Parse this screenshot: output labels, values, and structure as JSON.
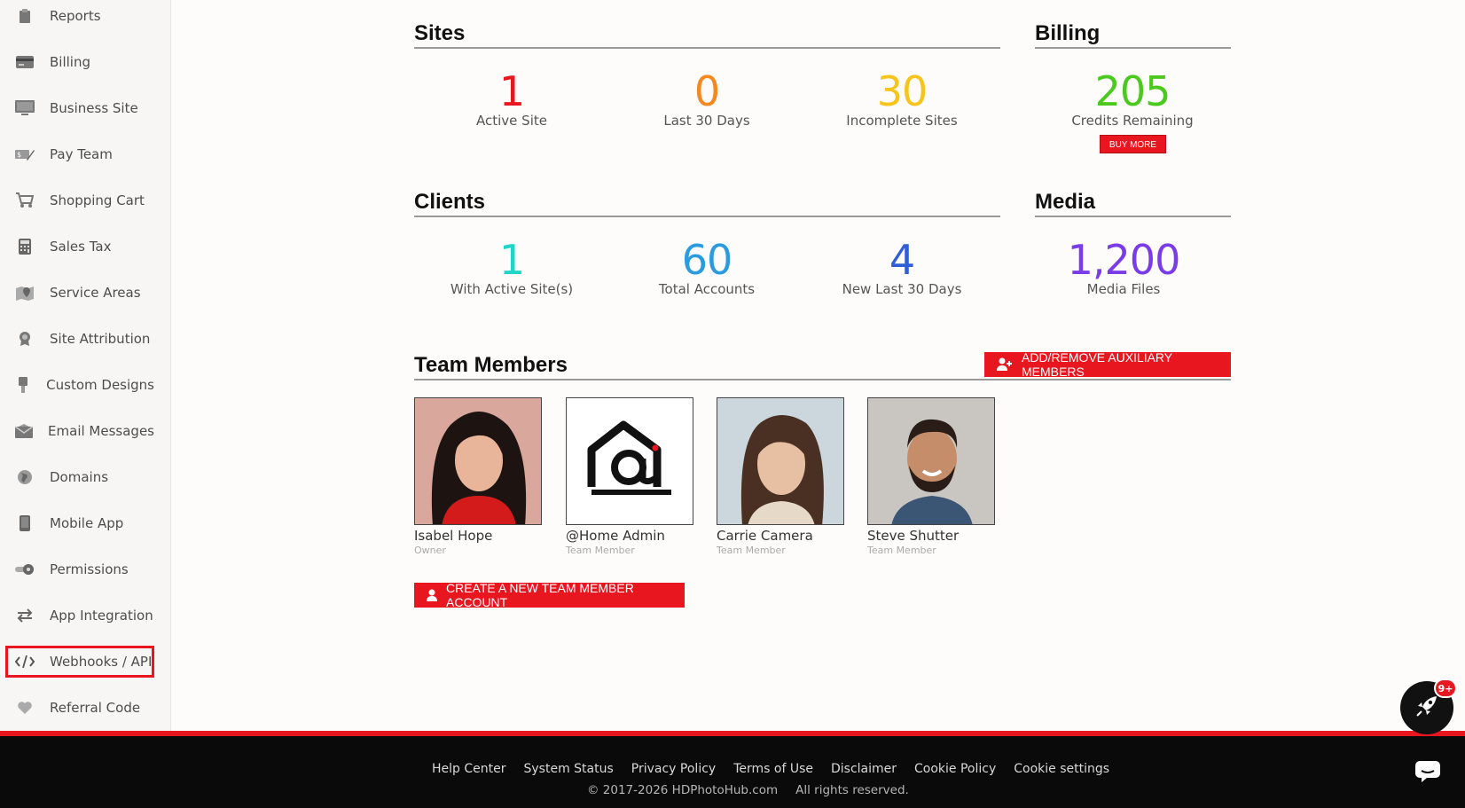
{
  "sidebar": {
    "items": [
      {
        "label": "Reports",
        "icon": "reports-icon"
      },
      {
        "label": "Billing",
        "icon": "credit-card-icon"
      },
      {
        "label": "Business Site",
        "icon": "monitor-icon"
      },
      {
        "label": "Pay Team",
        "icon": "pay-icon"
      },
      {
        "label": "Shopping Cart",
        "icon": "cart-icon"
      },
      {
        "label": "Sales Tax",
        "icon": "calculator-icon"
      },
      {
        "label": "Service Areas",
        "icon": "map-pin-icon"
      },
      {
        "label": "Site Attribution",
        "icon": "award-icon"
      },
      {
        "label": "Custom Designs",
        "icon": "brush-icon"
      },
      {
        "label": "Email Messages",
        "icon": "envelope-icon"
      },
      {
        "label": "Domains",
        "icon": "globe-icon"
      },
      {
        "label": "Mobile App",
        "icon": "mobile-icon"
      },
      {
        "label": "Permissions",
        "icon": "toggle-icon"
      },
      {
        "label": "App Integration",
        "icon": "arrows-icon"
      },
      {
        "label": "Webhooks / API",
        "icon": "code-icon",
        "active": true
      },
      {
        "label": "Referral Code",
        "icon": "heart-icon"
      }
    ]
  },
  "sites": {
    "title": "Sites",
    "stats": [
      {
        "value": "1",
        "caption": "Active Site",
        "color": "#e8161f"
      },
      {
        "value": "0",
        "caption": "Last 30 Days",
        "color": "#f5881f"
      },
      {
        "value": "30",
        "caption": "Incomplete Sites",
        "color": "#f7c41d"
      }
    ]
  },
  "billing": {
    "title": "Billing",
    "value": "205",
    "caption": "Credits Remaining",
    "color": "#4cc91f",
    "buy_label": "BUY MORE"
  },
  "clients": {
    "title": "Clients",
    "stats": [
      {
        "value": "1",
        "caption": "With Active Site(s)",
        "color": "#1fd6c8"
      },
      {
        "value": "60",
        "caption": "Total Accounts",
        "color": "#2b9be0"
      },
      {
        "value": "4",
        "caption": "New Last 30 Days",
        "color": "#2f5fd6"
      }
    ]
  },
  "media": {
    "title": "Media",
    "value": "1,200",
    "caption": "Media Files",
    "color": "#7a3be8"
  },
  "team": {
    "title": "Team Members",
    "add_remove_label": "ADD/REMOVE AUXILIARY MEMBERS",
    "create_label": "CREATE A NEW TEAM MEMBER ACCOUNT",
    "members": [
      {
        "name": "Isabel Hope",
        "role": "Owner"
      },
      {
        "name": "@Home Admin",
        "role": "Team Member"
      },
      {
        "name": "Carrie Camera",
        "role": "Team Member"
      },
      {
        "name": "Steve Shutter",
        "role": "Team Member"
      }
    ]
  },
  "footer": {
    "links": [
      "Help Center",
      "System Status",
      "Privacy Policy",
      "Terms of Use",
      "Disclaimer",
      "Cookie Policy",
      "Cookie settings"
    ],
    "copyright": "© 2017-2026 HDPhotoHub.com",
    "rights": "All rights reserved."
  },
  "widget": {
    "badge": "9+"
  },
  "colors": {
    "accent": "#e8161f",
    "footer_bg": "#0a0a0a"
  }
}
